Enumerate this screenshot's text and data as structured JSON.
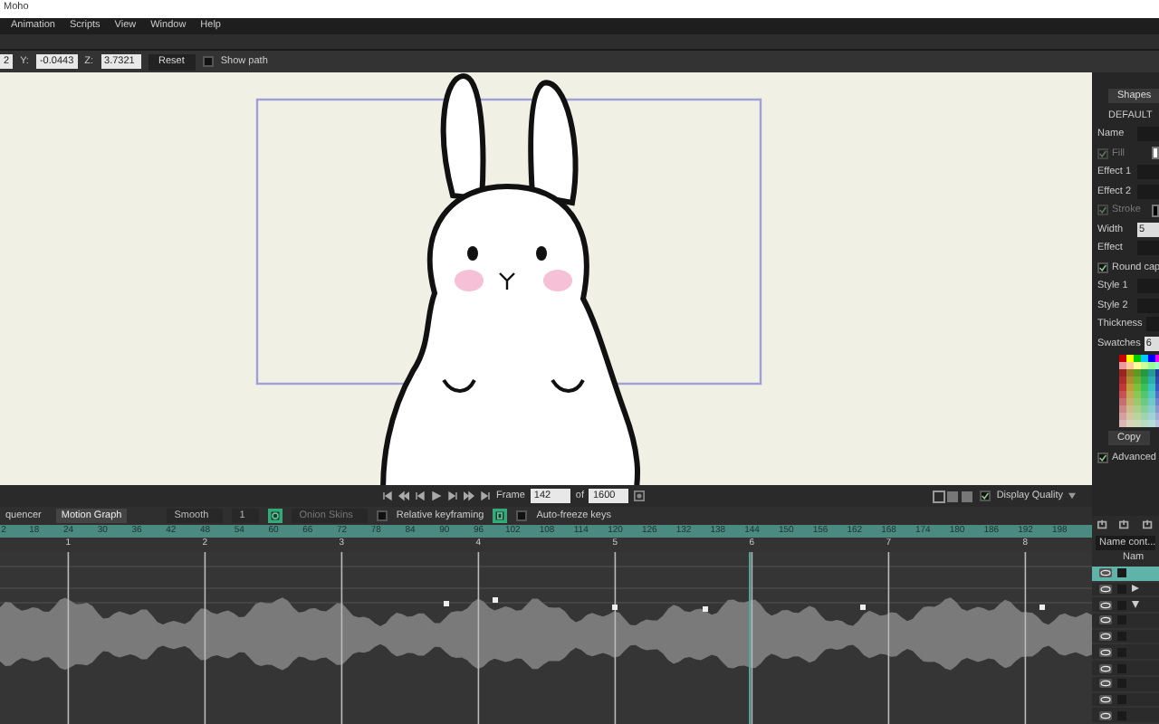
{
  "window": {
    "title": "Moho"
  },
  "menu": [
    "Animation",
    "Scripts",
    "View",
    "Window",
    "Help"
  ],
  "toolbar": {
    "x_value": "2",
    "y_label": "Y:",
    "y_value": "-0.0443",
    "z_label": "Z:",
    "z_value": "3.7321",
    "reset": "Reset",
    "show_path": {
      "label": "Show path",
      "checked": false
    }
  },
  "style_panel": [
    {
      "kind": "button",
      "label": "Shapes"
    },
    {
      "kind": "heading",
      "label": "DEFAULT"
    },
    {
      "kind": "field",
      "label": "Name"
    },
    {
      "kind": "check",
      "label": "Fill",
      "checked": true,
      "disabled": true,
      "color": "#ffffff"
    },
    {
      "kind": "field",
      "label": "Effect 1"
    },
    {
      "kind": "field",
      "label": "Effect 2"
    },
    {
      "kind": "check",
      "label": "Stroke",
      "checked": true,
      "disabled": true,
      "color": "#000000"
    },
    {
      "kind": "field",
      "label": "Width",
      "value": "5"
    },
    {
      "kind": "field",
      "label": "Effect"
    },
    {
      "kind": "check",
      "label": "Round cap",
      "checked": true,
      "disabled": false
    },
    {
      "kind": "field",
      "label": "Style 1"
    },
    {
      "kind": "field",
      "label": "Style 2"
    },
    {
      "kind": "field",
      "label": "Thickness"
    },
    {
      "kind": "field",
      "label": "Swatches",
      "value": "6"
    },
    {
      "kind": "palette"
    },
    {
      "kind": "button",
      "label": "Copy"
    },
    {
      "kind": "check",
      "label": "Advanced",
      "checked": true,
      "disabled": false
    }
  ],
  "playback": {
    "frame_label": "Frame",
    "frame": "142",
    "of_label": "of",
    "total": "1600",
    "display_quality": "Display Quality",
    "display_check": true
  },
  "timeline": {
    "tabs": [
      {
        "label": "quencer",
        "selected": false
      },
      {
        "label": "Motion Graph",
        "selected": true
      }
    ],
    "interpolation": "Smooth",
    "step": "1",
    "onion_skins": "Onion Skins",
    "options": [
      {
        "label": "Relative keyframing",
        "checked": false
      },
      {
        "label": "Auto-freeze keys",
        "checked": false
      }
    ],
    "ruler": [
      "2",
      "18",
      "24",
      "30",
      "36",
      "42",
      "48",
      "54",
      "60",
      "66",
      "72",
      "78",
      "84",
      "90",
      "96",
      "102",
      "108",
      "114",
      "120",
      "126",
      "132",
      "138",
      "144",
      "150",
      "156",
      "162",
      "168",
      "174",
      "180",
      "186",
      "192",
      "198"
    ],
    "seconds": [
      "1",
      "2",
      "3",
      "4",
      "5",
      "6",
      "7",
      "8"
    ]
  },
  "layers_panel": {
    "search": "Name cont...",
    "column": "Nam",
    "layers": [
      {
        "kind": "layer",
        "selected": true
      },
      {
        "kind": "group",
        "selected": false,
        "expanded": false
      },
      {
        "kind": "group",
        "selected": false,
        "expanded": true
      },
      {
        "kind": "layer",
        "selected": false
      },
      {
        "kind": "layer",
        "selected": false
      },
      {
        "kind": "layer",
        "selected": false
      },
      {
        "kind": "layer",
        "selected": false
      },
      {
        "kind": "layer",
        "selected": false
      },
      {
        "kind": "layer",
        "selected": false
      },
      {
        "kind": "layer",
        "selected": false
      }
    ]
  }
}
